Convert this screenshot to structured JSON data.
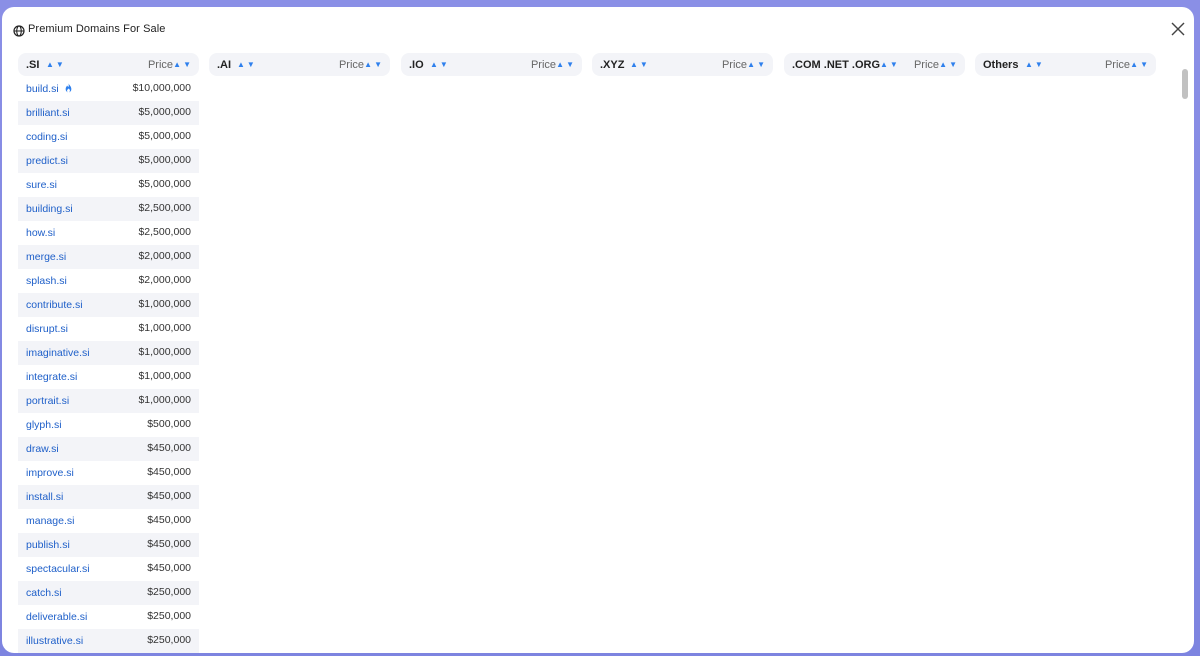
{
  "modal": {
    "title": "Premium Domains For Sale",
    "close_label": "×"
  },
  "columns": [
    {
      "name": ".SI",
      "price_label": "Price",
      "sort_arrows": "▲▼",
      "price_arrows": "▲▼"
    },
    {
      "name": ".AI",
      "price_label": "Price",
      "sort_arrows": "▲▼",
      "price_arrows": "▲▼"
    },
    {
      "name": ".IO",
      "price_label": "Price",
      "sort_arrows": "▲▼",
      "price_arrows": "▲▼"
    },
    {
      "name": ".XYZ",
      "price_label": "Price",
      "sort_arrows": "▲▼",
      "price_arrows": "▲▼"
    },
    {
      "name": ".COM .NET .ORG",
      "price_label": "Price",
      "sort_arrows": "▲▼",
      "price_arrows": "▲▼"
    },
    {
      "name": "Others",
      "price_label": "Price",
      "sort_arrows": "▲▼",
      "price_arrows": "▲▼"
    }
  ],
  "si_domains": [
    {
      "domain": "build.si",
      "price": "$10,000,000",
      "hot": true
    },
    {
      "domain": "brilliant.si",
      "price": "$5,000,000"
    },
    {
      "domain": "coding.si",
      "price": "$5,000,000"
    },
    {
      "domain": "predict.si",
      "price": "$5,000,000"
    },
    {
      "domain": "sure.si",
      "price": "$5,000,000"
    },
    {
      "domain": "building.si",
      "price": "$2,500,000"
    },
    {
      "domain": "how.si",
      "price": "$2,500,000"
    },
    {
      "domain": "merge.si",
      "price": "$2,000,000"
    },
    {
      "domain": "splash.si",
      "price": "$2,000,000"
    },
    {
      "domain": "contribute.si",
      "price": "$1,000,000"
    },
    {
      "domain": "disrupt.si",
      "price": "$1,000,000"
    },
    {
      "domain": "imaginative.si",
      "price": "$1,000,000"
    },
    {
      "domain": "integrate.si",
      "price": "$1,000,000"
    },
    {
      "domain": "portrait.si",
      "price": "$1,000,000"
    },
    {
      "domain": "glyph.si",
      "price": "$500,000"
    },
    {
      "domain": "draw.si",
      "price": "$450,000"
    },
    {
      "domain": "improve.si",
      "price": "$450,000"
    },
    {
      "domain": "install.si",
      "price": "$450,000"
    },
    {
      "domain": "manage.si",
      "price": "$450,000"
    },
    {
      "domain": "publish.si",
      "price": "$450,000"
    },
    {
      "domain": "spectacular.si",
      "price": "$450,000"
    },
    {
      "domain": "catch.si",
      "price": "$250,000"
    },
    {
      "domain": "deliverable.si",
      "price": "$250,000"
    },
    {
      "domain": "illustrative.si",
      "price": "$250,000"
    }
  ],
  "colors": {
    "accent": "#2f80ed",
    "link": "#1e5fc9",
    "header_bg": "#f3f4f8",
    "hot_icon": "#2f80ed"
  }
}
